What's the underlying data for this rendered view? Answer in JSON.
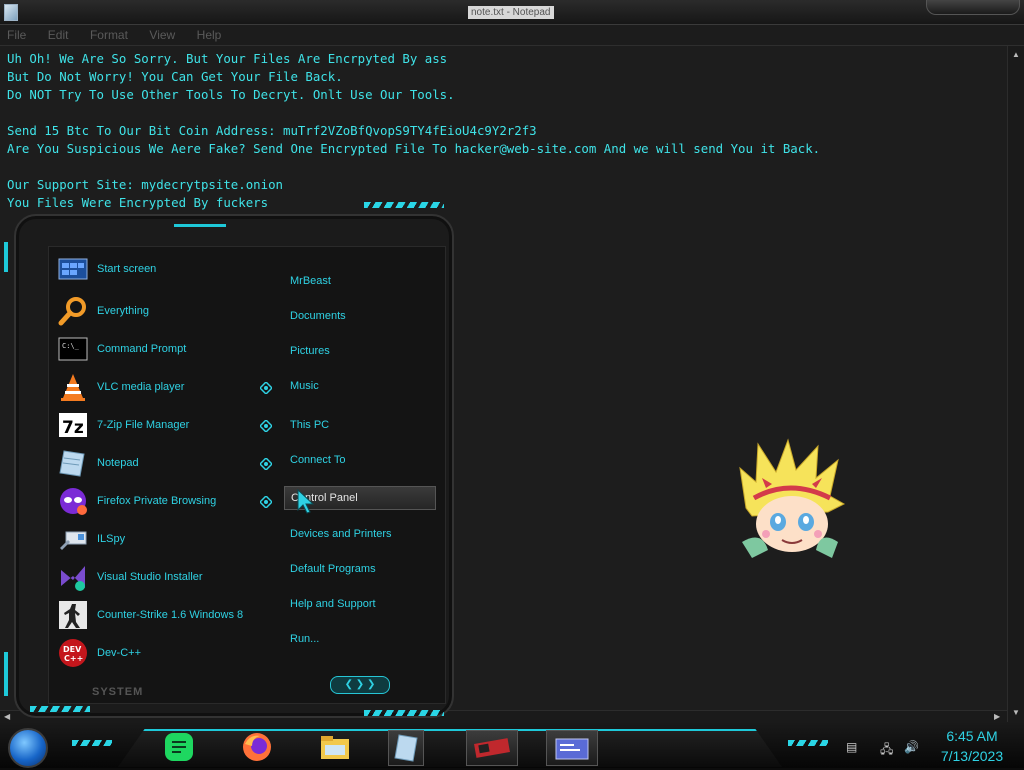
{
  "window": {
    "title": "note.txt - Notepad"
  },
  "menubar": {
    "items": [
      {
        "label": "File"
      },
      {
        "label": "Edit"
      },
      {
        "label": "Format"
      },
      {
        "label": "View"
      },
      {
        "label": "Help"
      }
    ]
  },
  "editor": {
    "lines": [
      "Uh Oh! We Are So Sorry. But Your Files Are Encrpyted By ass",
      "But Do Not Worry! You Can Get Your File Back.",
      "Do NOT Try To Use Other Tools To Decryt. Onlt Use Our Tools.",
      "",
      "Send 15 Btc To Our Bit Coin Address: muTrf2VZoBfQvopS9TY4fEioU4c9Y2r2f3",
      "Are You Suspicious We Aere Fake? Send One Encrypted File To hacker@web-site.com And we will send You it Back.",
      "",
      "Our Support Site: mydecrytpsite.onion",
      "You Files Were Encrypted By fuckers"
    ]
  },
  "start_menu": {
    "programs": [
      {
        "label": "Start screen",
        "icon": "start-screen-icon"
      },
      {
        "label": "Everything",
        "icon": "search-magnifier-icon"
      },
      {
        "label": "Command Prompt",
        "icon": "terminal-icon"
      },
      {
        "label": "VLC media player",
        "icon": "vlc-cone-icon"
      },
      {
        "label": "7-Zip File Manager",
        "icon": "7zip-icon"
      },
      {
        "label": "Notepad",
        "icon": "notepad-icon"
      },
      {
        "label": "Firefox Private Browsing",
        "icon": "firefox-private-icon"
      },
      {
        "label": "ILSpy",
        "icon": "ilspy-icon"
      },
      {
        "label": "Visual Studio Installer",
        "icon": "visual-studio-installer-icon"
      },
      {
        "label": "Counter-Strike 1.6 Windows 8",
        "icon": "counter-strike-icon"
      },
      {
        "label": "Dev-C++",
        "icon": "devcpp-icon"
      }
    ],
    "places": [
      {
        "label": "MrBeast"
      },
      {
        "label": "Documents"
      },
      {
        "label": "Pictures"
      },
      {
        "label": "Music"
      },
      {
        "label": "This PC"
      },
      {
        "label": "Connect To"
      },
      {
        "label": "Control Panel"
      },
      {
        "label": "Devices and Printers"
      },
      {
        "label": "Default Programs"
      },
      {
        "label": "Help and Support"
      },
      {
        "label": "Run..."
      }
    ],
    "footer_label": "SYSTEM",
    "nav_arrows": "❮ ❯ ❯"
  },
  "taskbar": {
    "pinned": [
      {
        "name": "notes-app-icon",
        "color": "#1ed760"
      },
      {
        "name": "firefox-icon",
        "color": "#ff7139"
      },
      {
        "name": "file-explorer-icon",
        "color": "#f2c94c"
      },
      {
        "name": "notepad-icon",
        "color": "#9cc3dc"
      },
      {
        "name": "graphics-card-icon",
        "color": "#c0282d"
      },
      {
        "name": "control-panel-icon",
        "color": "#5a6bd6"
      }
    ]
  },
  "clock": {
    "time": "6:45 AM",
    "date": "7/13/2023"
  },
  "colors": {
    "accent": "#2fd2e4",
    "text": "#3fe3e8",
    "background": "#1d1d1d"
  }
}
